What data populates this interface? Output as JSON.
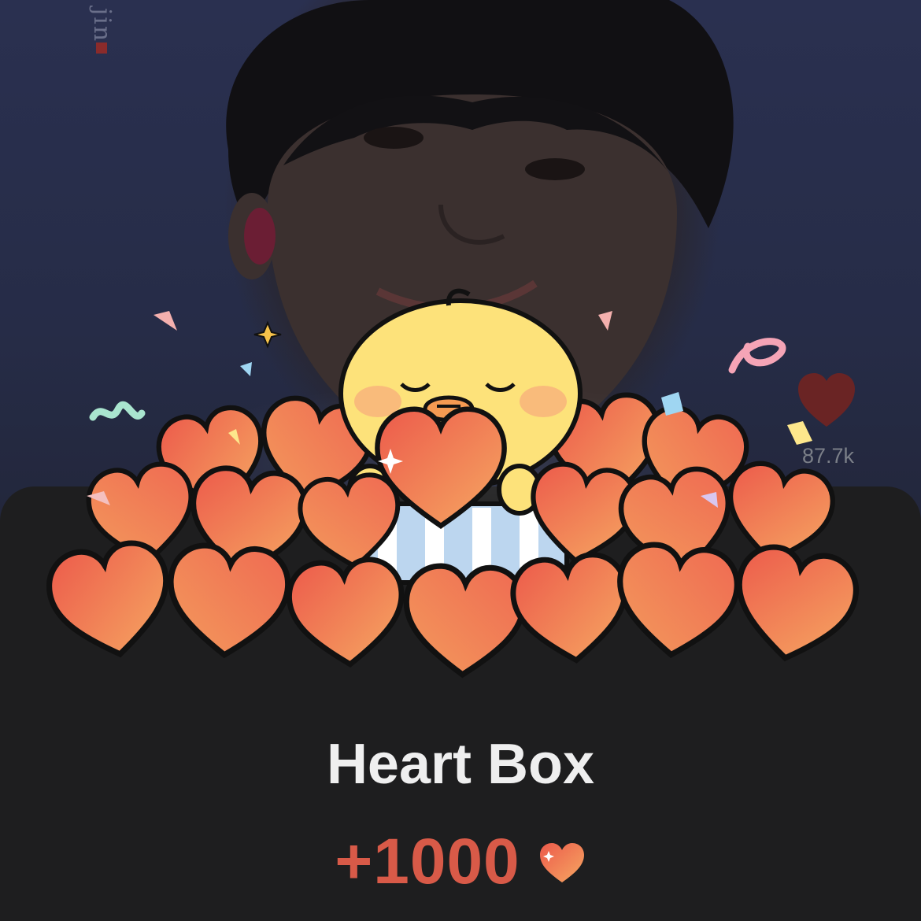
{
  "gift": {
    "title": "Heart Box",
    "amount": "+1000",
    "currency_icon": "heart-icon"
  },
  "background_photo": {
    "watermark": "jin"
  },
  "like_widget": {
    "icon": "heart-icon",
    "count": "87.7k"
  },
  "colors": {
    "sheet_bg": "#1e1e1f",
    "title": "#efefef",
    "amount": "#d85a48",
    "heart_top": "#ee5c4c",
    "heart_bottom": "#f4a05e",
    "chick": "#fde27a",
    "like_heart": "#6a2424"
  }
}
